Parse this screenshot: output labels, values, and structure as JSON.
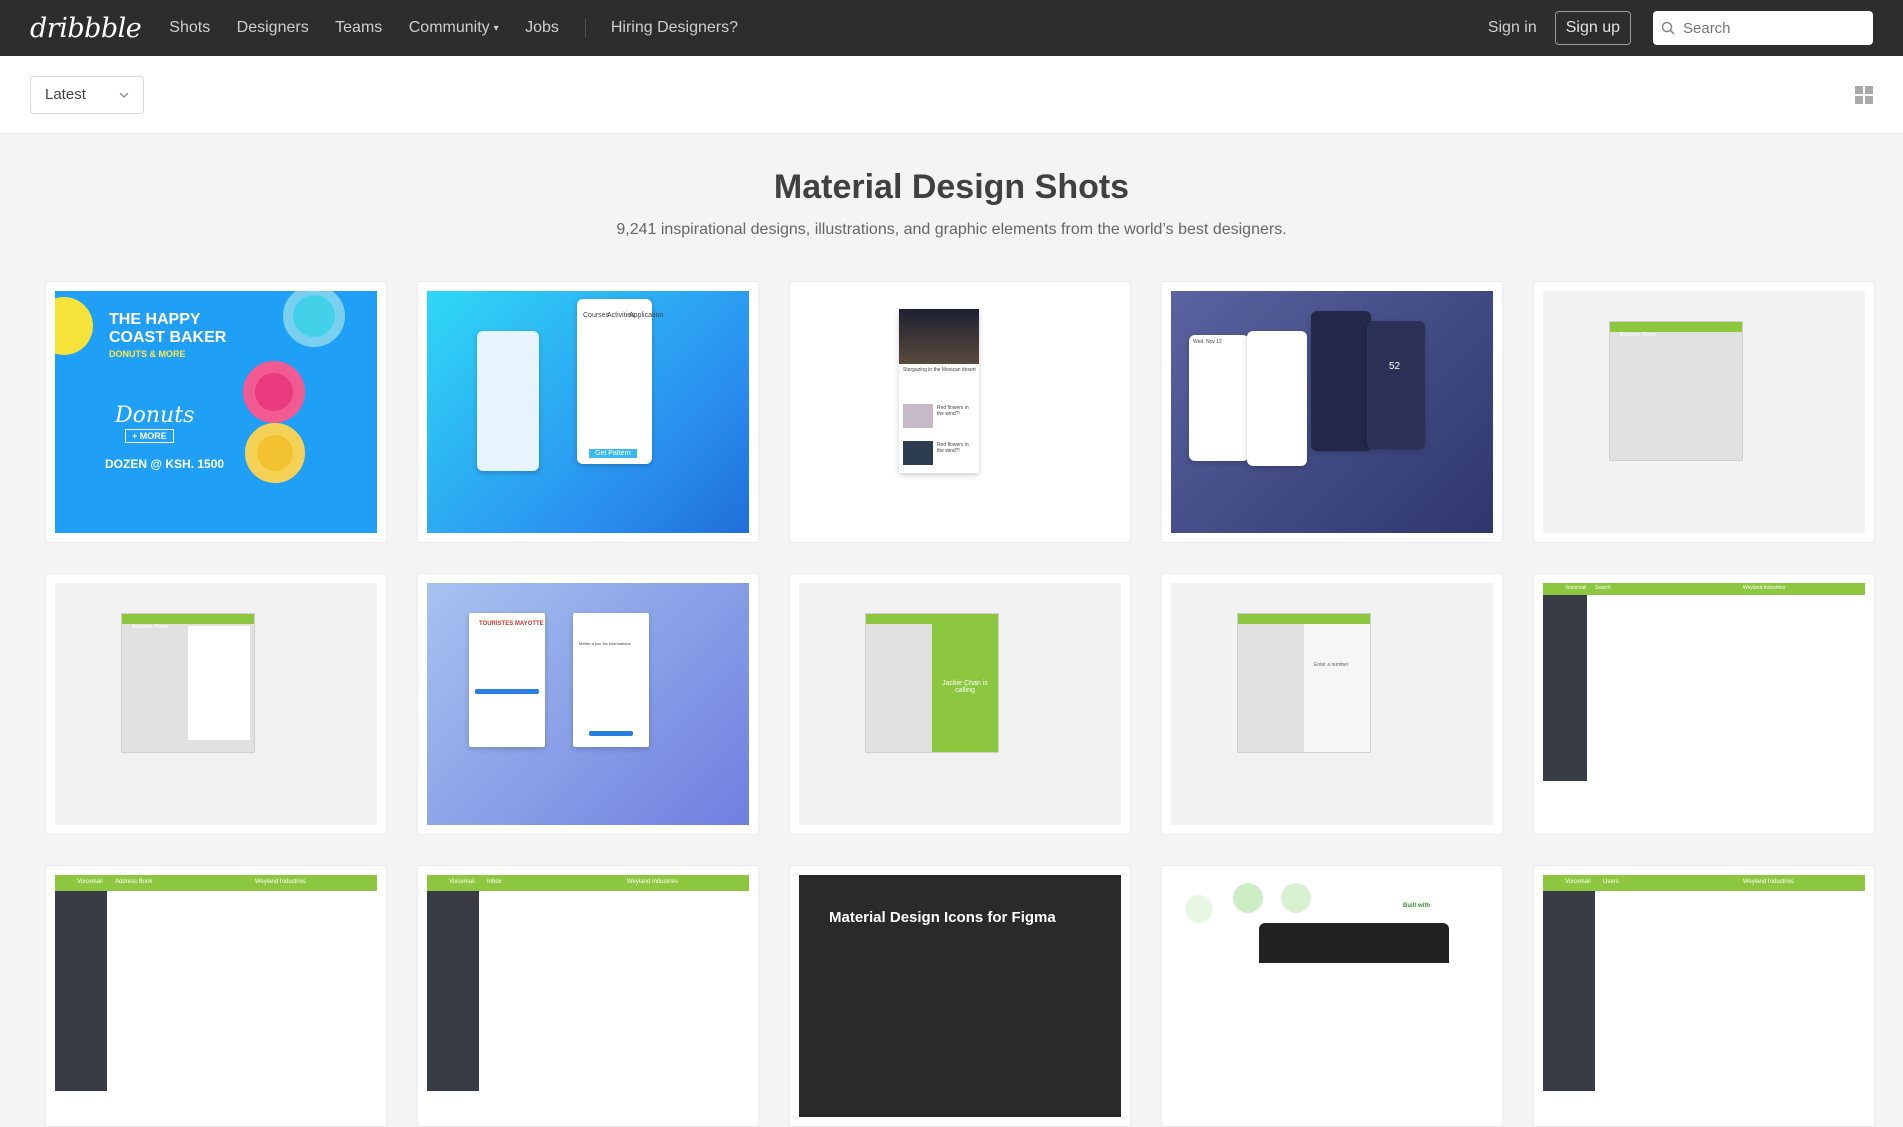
{
  "nav": {
    "logo": "dribbble",
    "links": [
      "Shots",
      "Designers",
      "Teams",
      "Community",
      "Jobs"
    ],
    "hiring": "Hiring Designers?",
    "signin": "Sign in",
    "signup": "Sign up",
    "search_placeholder": "Search"
  },
  "filter": {
    "sort_selected": "Latest"
  },
  "hero": {
    "title": "Material Design Shots",
    "subtitle": "9,241 inspirational designs, illustrations, and graphic elements from the world’s best designers."
  },
  "shots": [
    {
      "texts": [
        "THE HAPPY",
        "COAST BAKER",
        "DONUTS & MORE",
        "Donuts",
        "+ MORE",
        "DOZEN @ KSH. 1500"
      ]
    },
    {
      "texts": [
        "Courses",
        "Activities",
        "Application",
        "Get Pattern"
      ]
    },
    {
      "texts": [
        "Stargazing in the Mexican desert",
        "Red flowers in the wind?!",
        "Red flowers in the wind?!"
      ]
    },
    {
      "texts": [
        "Wed, Nov 12",
        "52"
      ]
    },
    {
      "texts": [
        "Business Phone"
      ]
    },
    {
      "texts": [
        "Business Phone"
      ]
    },
    {
      "texts": [
        "TOURISTES MAYOTTE",
        "Mettre à jour les informations"
      ]
    },
    {
      "texts": [
        "Jackie Chan is calling"
      ]
    },
    {
      "texts": [
        "Enter a number"
      ]
    },
    {
      "texts": [
        "Voicemail",
        "Search",
        "Weyland Industries"
      ]
    },
    {
      "texts": [
        "Voicemail",
        "Address Book",
        "Weyland Industries"
      ]
    },
    {
      "texts": [
        "Voicemail",
        "Inbox",
        "Weyland Industries"
      ]
    },
    {
      "texts": [
        "Material Design Icons for Figma"
      ]
    },
    {
      "texts": [
        "Built with"
      ]
    },
    {
      "texts": [
        "Voicemail",
        "Users",
        "Weyland Industries"
      ]
    }
  ]
}
